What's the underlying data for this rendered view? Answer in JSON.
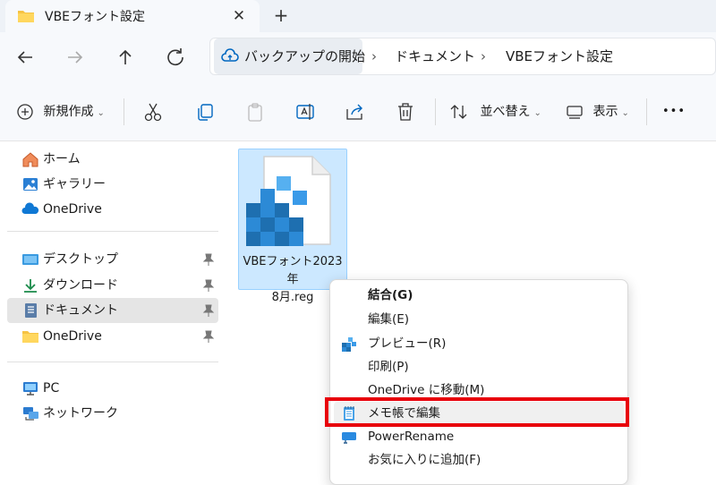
{
  "tab": {
    "title": "VBEフォント設定",
    "close_glyph": "✕",
    "new_tab_glyph": "+"
  },
  "address": {
    "segments": [
      "バックアップの開始",
      "ドキュメント",
      "VBEフォント設定"
    ],
    "separator": "›"
  },
  "toolbar": {
    "new_label": "新規作成",
    "sort_label": "並べ替え",
    "view_label": "表示",
    "more_glyph": "•••",
    "chevron": "⌄"
  },
  "sidebar": {
    "group1": [
      {
        "label": "ホーム",
        "icon": "home-icon"
      },
      {
        "label": "ギャラリー",
        "icon": "gallery-icon"
      },
      {
        "label": "OneDrive",
        "icon": "cloud-icon"
      }
    ],
    "group2": [
      {
        "label": "デスクトップ",
        "icon": "desktop-icon",
        "pinned": true
      },
      {
        "label": "ダウンロード",
        "icon": "download-icon",
        "pinned": true
      },
      {
        "label": "ドキュメント",
        "icon": "document-icon",
        "pinned": true,
        "selected": true
      },
      {
        "label": "OneDrive",
        "icon": "folder-icon",
        "pinned": true
      }
    ],
    "group3": [
      {
        "label": "PC",
        "icon": "pc-icon"
      },
      {
        "label": "ネットワーク",
        "icon": "network-icon"
      }
    ]
  },
  "file": {
    "name_line1": "VBEフォント2023年",
    "name_line2": "8月.reg",
    "icon": "registry-file-icon"
  },
  "context_menu": {
    "items": [
      {
        "label": "結合(G)",
        "bold": true,
        "icon": ""
      },
      {
        "label": "編集(E)",
        "icon": ""
      },
      {
        "label": "プレビュー(R)",
        "icon": "registry-preview-icon"
      },
      {
        "label": "印刷(P)",
        "icon": ""
      },
      {
        "label": "OneDrive に移動(M)",
        "icon": ""
      },
      {
        "label": "メモ帳で編集",
        "icon": "notepad-icon"
      },
      {
        "label": "PowerRename",
        "icon": "powerrename-icon"
      },
      {
        "label": "お気に入りに追加(F)",
        "icon": ""
      }
    ],
    "highlighted_item": "メモ帳で編集"
  },
  "colors": {
    "selection": "#cce8ff",
    "highlight_box": "#e8000b",
    "accent": "#0067c0"
  }
}
